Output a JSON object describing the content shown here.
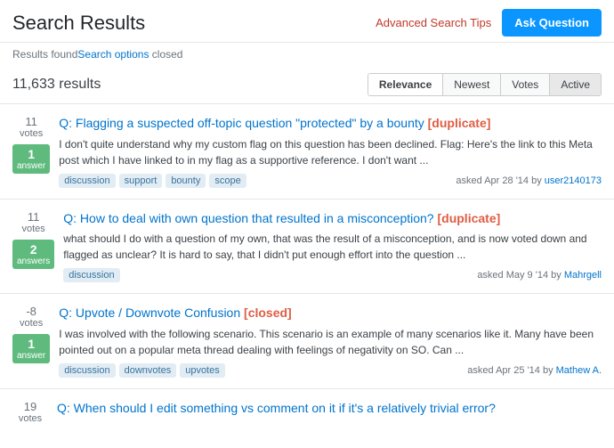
{
  "header": {
    "title": "Search Results",
    "advanced_search_label": "Advanced Search Tips",
    "ask_question_label": "Ask Question"
  },
  "subheader": {
    "text_prefix": "Results found",
    "search_options_label": "Search options",
    "text_suffix": "closed"
  },
  "results_bar": {
    "count_text": "11,633 results",
    "sort_tabs": [
      {
        "label": "Relevance",
        "active": true
      },
      {
        "label": "Newest",
        "active": false
      },
      {
        "label": "Votes",
        "active": false
      },
      {
        "label": "Active",
        "active": false,
        "highlight": true
      }
    ]
  },
  "results": [
    {
      "votes": "11",
      "votes_label": "votes",
      "answers": "1",
      "answer_label": "answer",
      "title_prefix": "Q: Flagging a suspected off-topic question “protected” by a bounty",
      "title_badge": "[duplicate]",
      "excerpt": "I don't quite understand why my custom flag on this question has been declined. Flag: Here's the link to this Meta post which I have linked to in my flag as a supportive reference. I don't want ...",
      "tags": [
        "discussion",
        "support",
        "bounty",
        "scope"
      ],
      "asked_text": "asked Apr 28 '14 by",
      "user": "user2140173",
      "badge_color": "#5eba7d"
    },
    {
      "votes": "11",
      "votes_label": "votes",
      "answers": "2",
      "answer_label": "answers",
      "title_prefix": "Q: How to deal with own question that resulted in a misconception?",
      "title_badge": "[duplicate]",
      "excerpt": "what should I do with a question of my own, that was the result of a misconception, and is now voted down and flagged as unclear? It is hard to say, that I didn't put enough effort into the question ...",
      "tags": [
        "discussion"
      ],
      "asked_text": "asked May 9 '14 by",
      "user": "Mahrgell",
      "badge_color": "#5eba7d"
    },
    {
      "votes": "-8",
      "votes_label": "votes",
      "answers": "1",
      "answer_label": "answer",
      "title_prefix": "Q: Upvote / Downvote Confusion",
      "title_badge": "[closed]",
      "excerpt": "I was involved with the following scenario. This scenario is an example of many scenarios like it. Many have been pointed out on a popular meta thread dealing with feelings of negativity on SO. Can ...",
      "tags": [
        "discussion",
        "downvotes",
        "upvotes"
      ],
      "asked_text": "asked Apr 25 '14 by",
      "user": "Mathew A.",
      "badge_color": "#5eba7d"
    }
  ],
  "last_result": {
    "votes": "19",
    "votes_label": "votes",
    "title": "Q: When should I edit something vs comment on it if it's a relatively trivial error?"
  },
  "colors": {
    "link": "#0074cc",
    "badge_red": "#e05d44",
    "badge_green": "#5eba7d",
    "sort_active_bg": "#e8e8e8"
  }
}
